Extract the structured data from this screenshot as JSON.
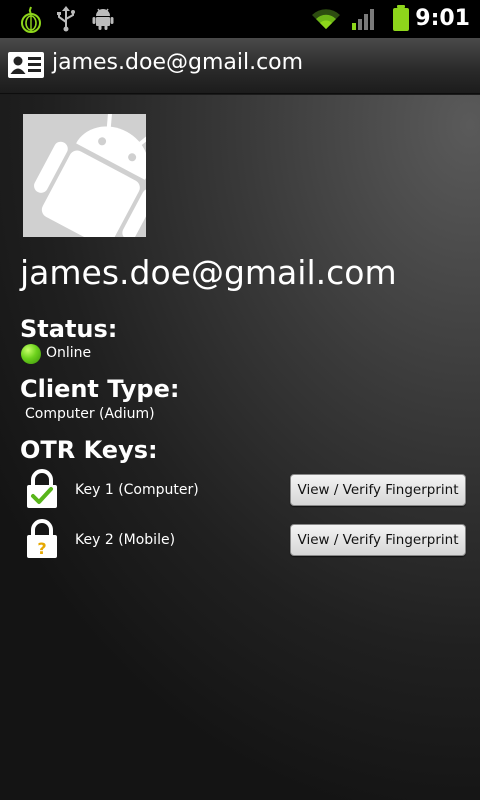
{
  "status_bar": {
    "icons": [
      "onion-icon",
      "usb-icon",
      "android-debug-icon",
      "wifi-icon",
      "signal-icon",
      "battery-icon"
    ],
    "time": "9:01"
  },
  "title_bar": {
    "icon": "contact-card-icon",
    "title": "james.doe@gmail.com"
  },
  "contact": {
    "avatar_icon": "android-robot-icon",
    "name": "james.doe@gmail.com"
  },
  "status": {
    "heading": "Status:",
    "value": "Online",
    "color": "#6cd21c"
  },
  "client_type": {
    "heading": "Client Type:",
    "value": "Computer (Adium)"
  },
  "otr_keys": {
    "heading": "OTR Keys:",
    "keys": [
      {
        "label": "Key 1 (Computer)",
        "lock_icon": "lock-verified-icon",
        "button": "View / Verify Fingerprint"
      },
      {
        "label": "Key 2 (Mobile)",
        "lock_icon": "lock-unverified-icon",
        "button": "View / Verify Fingerprint"
      }
    ]
  },
  "colors": {
    "accent_green": "#6cd21c",
    "battery_green": "#8ed61b",
    "question_yellow": "#e6a800"
  }
}
